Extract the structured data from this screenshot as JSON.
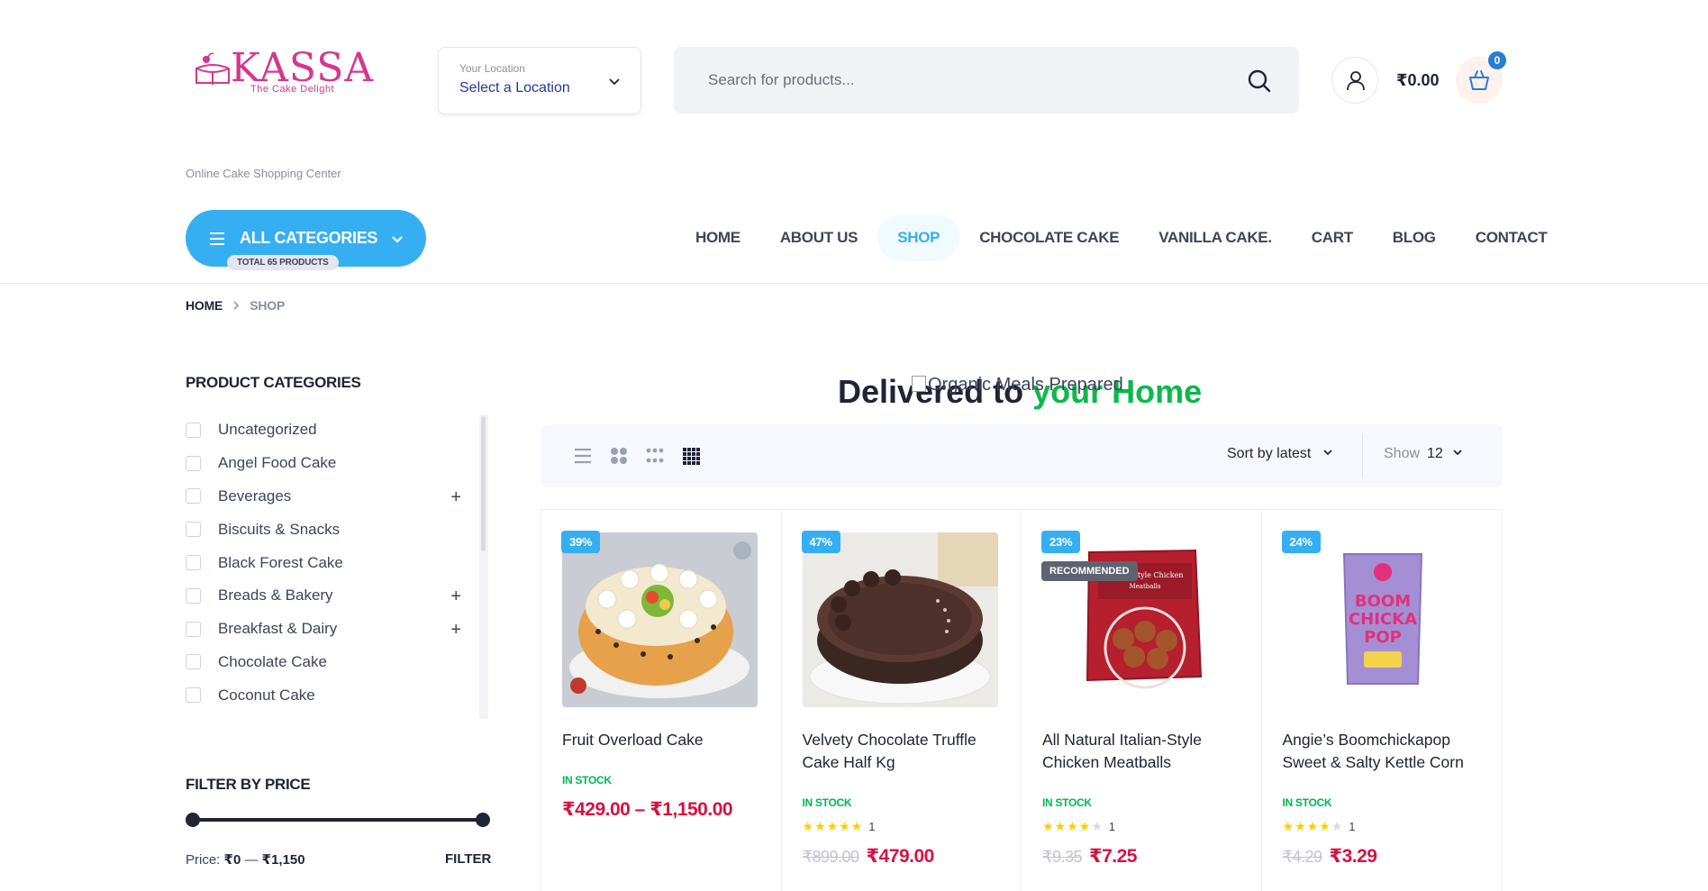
{
  "brand": {
    "name": "KASSA",
    "tagline_small": "The Cake Delight",
    "tagline": "Online Cake Shopping Center",
    "color": "#d4378f"
  },
  "location": {
    "label": "Your Location",
    "value": "Select a Location"
  },
  "search": {
    "placeholder": "Search for products..."
  },
  "cart": {
    "total": "₹0.00",
    "count": "0"
  },
  "all_categories": {
    "label": "ALL CATEGORIES",
    "badge": "TOTAL 65 PRODUCTS",
    "color": "#35aff1"
  },
  "nav": {
    "items": [
      {
        "label": "HOME"
      },
      {
        "label": "ABOUT US"
      },
      {
        "label": "SHOP"
      },
      {
        "label": "CHOCOLATE CAKE"
      },
      {
        "label": "VANILLA CAKE."
      },
      {
        "label": "CART"
      },
      {
        "label": "BLOG"
      },
      {
        "label": "CONTACT"
      }
    ]
  },
  "breadcrumb": {
    "home": "HOME",
    "current": "SHOP"
  },
  "sidebar": {
    "categories_title": "PRODUCT CATEGORIES",
    "categories": [
      {
        "label": "Uncategorized",
        "expand": ""
      },
      {
        "label": "Angel Food Cake",
        "expand": ""
      },
      {
        "label": "Beverages",
        "expand": "+"
      },
      {
        "label": "Biscuits & Snacks",
        "expand": ""
      },
      {
        "label": "Black Forest Cake",
        "expand": ""
      },
      {
        "label": "Breads & Bakery",
        "expand": "+"
      },
      {
        "label": "Breakfast & Dairy",
        "expand": "+"
      },
      {
        "label": "Chocolate Cake",
        "expand": ""
      },
      {
        "label": "Coconut Cake",
        "expand": ""
      }
    ],
    "price_title": "FILTER BY PRICE",
    "price_prefix": "Price:",
    "price_min": "₹0",
    "price_dash": "—",
    "price_max": "₹1,150",
    "filter_label": "FILTER"
  },
  "banner": {
    "title_dark": "Delivered to ",
    "title_green": "your Home",
    "image_alt": "Organic Meals Prepared"
  },
  "toolbar": {
    "sort_label": "Sort by latest",
    "show_label": "Show",
    "show_value": "12"
  },
  "products": [
    {
      "name": "Fruit Overload Cake",
      "badge": "39%",
      "recommended": "",
      "stock": "IN STOCK",
      "rating": 0,
      "rating_count": "",
      "old_price": "",
      "price": "₹429.00 – ₹1,150.00"
    },
    {
      "name": "Velvety Chocolate Truffle Cake Half Kg",
      "badge": "47%",
      "recommended": "",
      "stock": "IN STOCK",
      "rating": 5,
      "rating_count": "1",
      "old_price": "₹899.00",
      "price": "₹479.00"
    },
    {
      "name": "All Natural Italian-Style Chicken Meatballs",
      "badge": "23%",
      "recommended": "RECOMMENDED",
      "stock": "IN STOCK",
      "rating": 4,
      "rating_count": "1",
      "old_price": "₹9.35",
      "price": "₹7.25"
    },
    {
      "name": "Angie’s Boomchickapop Sweet & Salty Kettle Corn",
      "badge": "24%",
      "recommended": "",
      "stock": "IN STOCK",
      "rating": 4,
      "rating_count": "1",
      "old_price": "₹4.29",
      "price": "₹3.29"
    }
  ],
  "product_art": {
    "p2_bag_text_1": "BOOM",
    "p2_bag_text_2": "CHICKA",
    "p2_bag_text_3": "POP",
    "p3_bag_title": "Italian-Style Chicken",
    "p3_bag_sub": "Meatballs"
  },
  "colors": {
    "price": "#d51243",
    "stock": "#00b853",
    "accent": "#35aff1",
    "star": "#ffcd00"
  }
}
